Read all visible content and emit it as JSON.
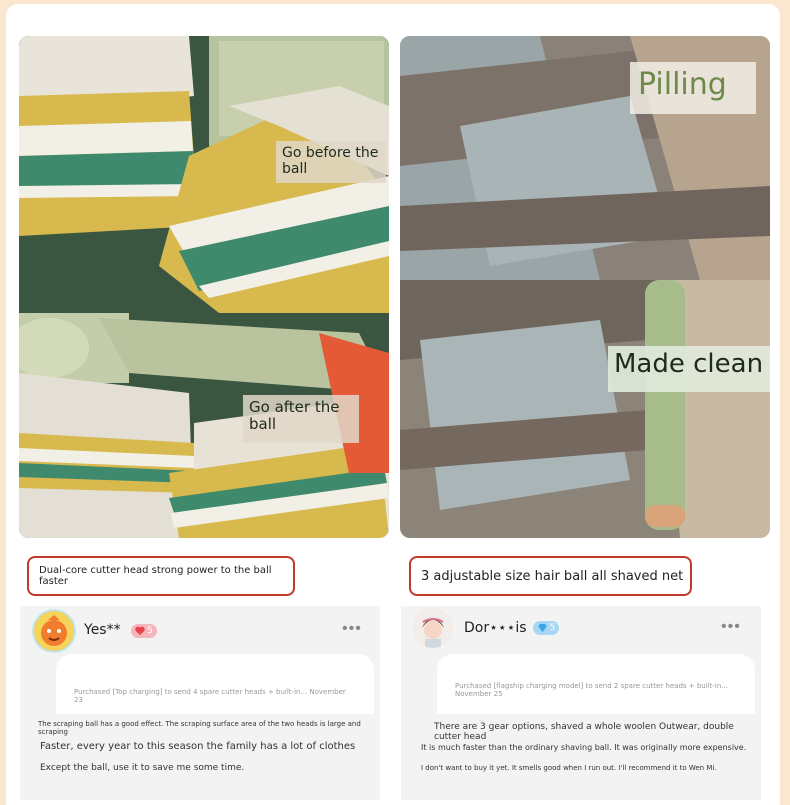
{
  "photos": {
    "before": {
      "label": "Go before the ball"
    },
    "after": {
      "label": "Go after the ball"
    },
    "pilling": {
      "label": "Pilling"
    },
    "clean": {
      "label": "Made clean"
    }
  },
  "callouts": {
    "left": "Dual-core cutter head strong power to the ball faster",
    "right": "3 adjustable size hair ball all shaved net"
  },
  "reviews": [
    {
      "user": "Yes**",
      "level": "5",
      "purchase": "Purchased [Top charging] to send 4 spare cutter heads + built-in... November 23",
      "lines": [
        "The scraping ball has a good effect. The scraping surface area of the two heads is large and scraping",
        "Faster, every year to this season the family has a lot of clothes",
        "Except the ball, use it to save me some time."
      ]
    },
    {
      "user": "Dor⋆⋆⋆is",
      "level": "5",
      "purchase": "Purchased [flagship charging model] to send 2 spare cutter heads + built-in... November 25",
      "lines": [
        "There are 3 gear options, shaved a whole woolen Outwear, double cutter head",
        "It is much faster than the ordinary shaving ball. It was originally more expensive.",
        "I don't want to buy it yet. It smells good when I run out. I'll recommend it to Wen Mi."
      ]
    }
  ],
  "colors": {
    "callout_border": "#c03a2b",
    "page_bg": "#fbe6cf",
    "review_bg": "#f3f3f3",
    "heart_badge": "#e8434f",
    "diamond_badge": "#3aa6ea"
  },
  "icons": {
    "more": "more-dots-icon",
    "heart": "heart-badge-icon",
    "diamond": "diamond-badge-icon"
  }
}
